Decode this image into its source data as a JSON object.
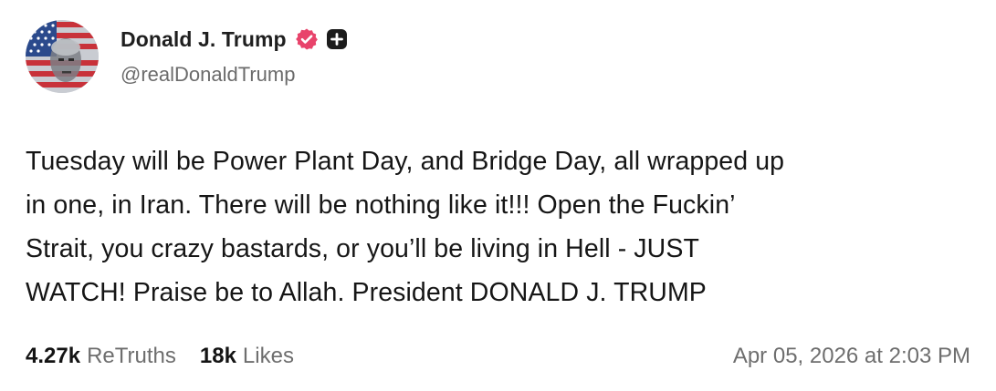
{
  "author": {
    "display_name": "Donald J. Trump",
    "handle": "@realDonaldTrump",
    "verified_icon": "verified-badge-icon",
    "plus_icon": "plus-badge-icon",
    "verified_color": "#e8436b"
  },
  "post": {
    "lines": [
      "Tuesday will be Power Plant Day, and Bridge Day, all wrapped up",
      "in one, in Iran. There will be nothing like it!!! Open the Fuckin’",
      "Strait, you crazy bastards, or you’ll be living in Hell - JUST",
      "WATCH! Praise be to Allah. President DONALD J. TRUMP"
    ]
  },
  "stats": {
    "retruths_count": "4.27k",
    "retruths_label": "ReTruths",
    "likes_count": "18k",
    "likes_label": "Likes"
  },
  "timestamp": "Apr 05, 2026 at 2:03 PM"
}
